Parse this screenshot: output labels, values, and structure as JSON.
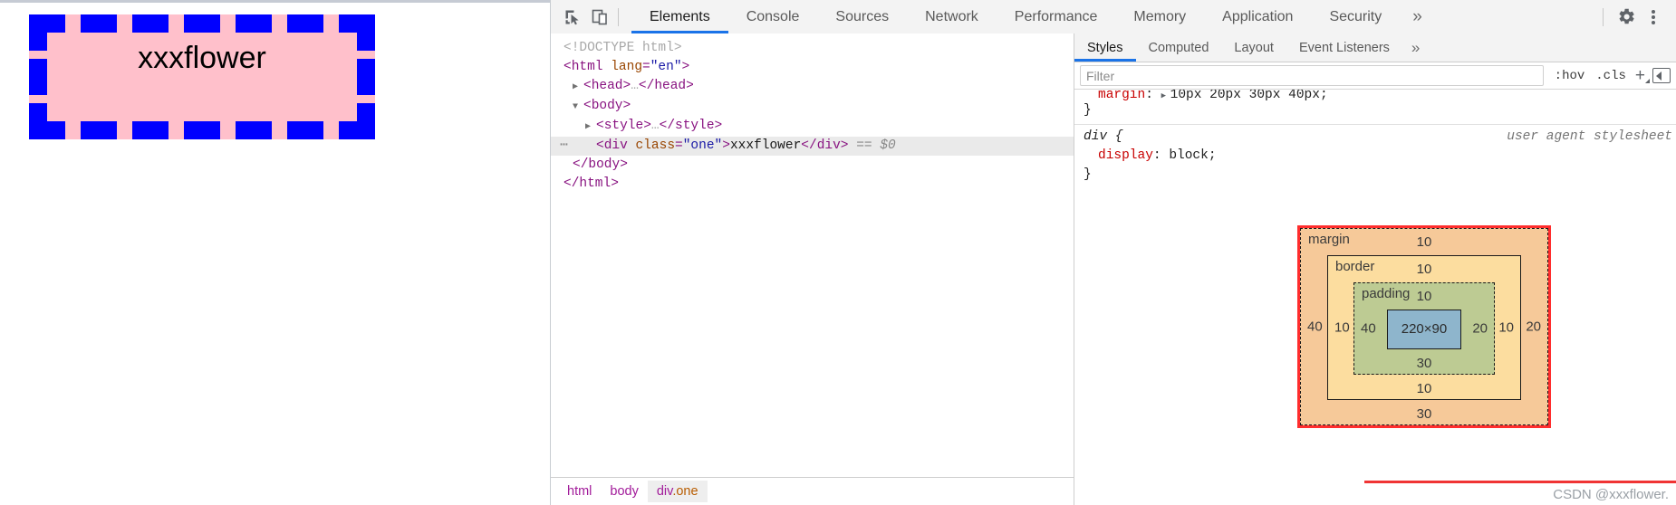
{
  "rendered_page": {
    "box_text": "xxxflower",
    "background_color": "#ffc0cb",
    "border_color": "#0000ff",
    "border_style": "dashed"
  },
  "devtools": {
    "toolbar": {
      "inspect_icon": "inspect-cursor-icon",
      "device_toolbar_icon": "device-toggle-icon",
      "tabs": [
        {
          "label": "Elements",
          "active": true
        },
        {
          "label": "Console",
          "active": false
        },
        {
          "label": "Sources",
          "active": false
        },
        {
          "label": "Network",
          "active": false
        },
        {
          "label": "Performance",
          "active": false
        },
        {
          "label": "Memory",
          "active": false
        },
        {
          "label": "Application",
          "active": false
        },
        {
          "label": "Security",
          "active": false
        }
      ],
      "more_tabs": "»",
      "settings_icon": "gear-icon",
      "menu_icon": "kebab-menu-icon"
    },
    "dom_tree": {
      "rows": [
        {
          "doctype": "<!DOCTYPE html>"
        },
        {
          "open": "<html lang=\"en\">"
        },
        {
          "collapsed": "<head>…</head>"
        },
        {
          "open": "<body>"
        },
        {
          "collapsed": "<style>…</style>"
        },
        {
          "selected": "<div class=\"one\">xxxflower</div> == $0"
        },
        {
          "close": "</body>"
        },
        {
          "close": "</html>"
        }
      ],
      "tag_html": "html",
      "attr_lang": "lang",
      "val_en": "\"en\"",
      "tag_head": "head",
      "tag_body": "body",
      "tag_style": "style",
      "tag_div": "div",
      "attr_class": "class",
      "val_one": "\"one\"",
      "div_text": "xxxflower",
      "selected_marker": "== $0",
      "ellipsis": "…",
      "gutter_dots": "⋯"
    },
    "breadcrumb": {
      "items": [
        {
          "label": "html",
          "active": false
        },
        {
          "label": "body",
          "active": false
        },
        {
          "label": "div",
          "suffix": ".one",
          "active": true
        }
      ]
    },
    "styles_panel": {
      "tabs": [
        {
          "label": "Styles",
          "active": true
        },
        {
          "label": "Computed",
          "active": false
        },
        {
          "label": "Layout",
          "active": false
        },
        {
          "label": "Event Listeners",
          "active": false
        }
      ],
      "more_tabs": "»",
      "filter_placeholder": "Filter",
      "hov_label": ":hov",
      "cls_label": ".cls",
      "plus_label": "+",
      "rules": {
        "clipped_prop": "margin",
        "clipped_value": "10px 20px 30px 40px;",
        "clipped_close": "}",
        "ua_selector": "div {",
        "ua_origin": "user agent stylesheet",
        "ua_prop": "display",
        "ua_value": "block;",
        "ua_close": "}"
      }
    },
    "box_model": {
      "margin_label": "margin",
      "margin_top": "10",
      "margin_right": "20",
      "margin_bottom": "30",
      "margin_left": "40",
      "border_label": "border",
      "border_top": "10",
      "border_right": "10",
      "border_bottom": "10",
      "border_left": "10",
      "padding_label": "padding",
      "padding_top": "10",
      "padding_right": "20",
      "padding_bottom": "30",
      "padding_left": "40",
      "content_size": "220×90",
      "colors": {
        "margin": "#f6c999",
        "border": "#fcdd9f",
        "padding": "#bdcb93",
        "content": "#8eb5cc",
        "highlight": "#ff2d2d"
      }
    }
  },
  "watermark": {
    "text": "CSDN @xxxflower."
  }
}
